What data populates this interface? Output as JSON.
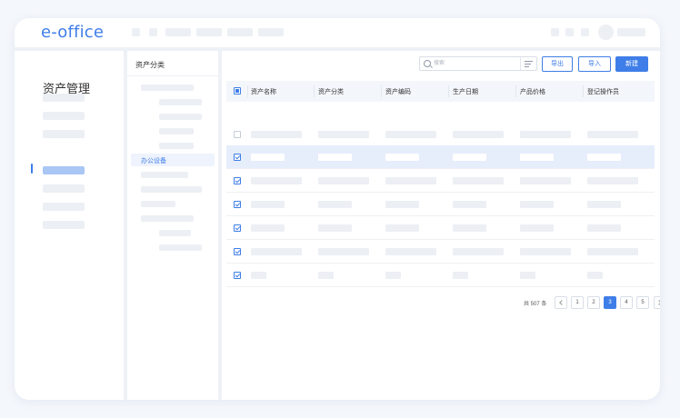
{
  "app": {
    "logo": "e-office",
    "title": "资产管理"
  },
  "category_panel": {
    "title": "资产分类",
    "active_item": "办公设备"
  },
  "toolbar": {
    "search_placeholder": "搜索",
    "export_label": "导出",
    "import_label": "导入",
    "new_label": "新建"
  },
  "table": {
    "columns": [
      "资产名称",
      "资产分类",
      "资产编码",
      "生产日期",
      "产品价格",
      "登记操作员"
    ],
    "rows": [
      {
        "checked": false,
        "highlight": false
      },
      {
        "checked": true,
        "highlight": true
      },
      {
        "checked": true,
        "highlight": false
      },
      {
        "checked": true,
        "highlight": false
      },
      {
        "checked": true,
        "highlight": false
      },
      {
        "checked": true,
        "highlight": false
      },
      {
        "checked": true,
        "highlight": false
      }
    ]
  },
  "pagination": {
    "total": "共 507 条",
    "pages": [
      "1",
      "2",
      "3",
      "4",
      "5"
    ],
    "current": "3"
  },
  "colors": {
    "accent": "#3f7ee8",
    "placeholder": "#eceff4",
    "highlight_row": "#e6edfb"
  },
  "icons": {
    "search": "search-icon",
    "filter": "filter-icon",
    "prev": "chevron-left-icon",
    "next": "chevron-right-icon"
  }
}
